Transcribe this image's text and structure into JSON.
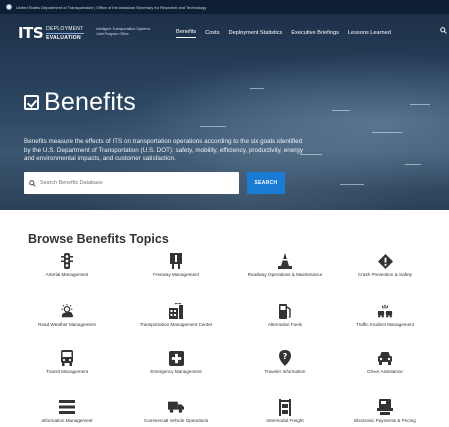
{
  "gov_bar": {
    "text": "United States Department of Transportation | Office of the Assistant Secretary for Research and Technology"
  },
  "logo": {
    "its": "ITS",
    "line1": "DEPLOYMENT",
    "line2": "EVALUATION"
  },
  "tagline": "Intelligent Transportation Systems Joint Program Office",
  "nav": [
    "Benefits",
    "Costs",
    "Deployment Statistics",
    "Executive Briefings",
    "Lessons Learned"
  ],
  "hero": {
    "title": "Benefits",
    "description": "Benefits measure the effects of ITS on transportation operations according to the six goals identified by the U.S. Department of Transportation (U.S. DOT): safety, mobility, efficiency, productivity, energy and environmental impacts, and customer satisfaction."
  },
  "search": {
    "placeholder": "Search Benefits Database",
    "button": "SEARCH"
  },
  "browse_title": "Browse Benefits Topics",
  "topics": [
    {
      "label": "Arterial Management",
      "icon": "traffic-light-icon"
    },
    {
      "label": "Freeway Management",
      "icon": "road-sign-icon"
    },
    {
      "label": "Roadway Operations & Maintenance",
      "icon": "traffic-cone-icon"
    },
    {
      "label": "Crash Prevention & Safety",
      "icon": "warning-diamond-icon"
    },
    {
      "label": "Road Weather Management",
      "icon": "weather-icon"
    },
    {
      "label": "Transportation Management Center",
      "icon": "management-center-icon"
    },
    {
      "label": "Alternative Fuels",
      "icon": "fuel-pump-icon"
    },
    {
      "label": "Traffic Incident Management",
      "icon": "incident-icon"
    },
    {
      "label": "Transit Management",
      "icon": "bus-icon"
    },
    {
      "label": "Emergency Management",
      "icon": "medical-cross-icon"
    },
    {
      "label": "Traveler Information",
      "icon": "location-pin-icon"
    },
    {
      "label": "Driver Assistance",
      "icon": "car-icon"
    },
    {
      "label": "Information Management",
      "icon": "list-icon"
    },
    {
      "label": "Commercial Vehicle Operations",
      "icon": "truck-icon"
    },
    {
      "label": "Intermodal Freight",
      "icon": "freight-crane-icon"
    },
    {
      "label": "Electronic Payments & Pricing",
      "icon": "payment-icon"
    }
  ]
}
